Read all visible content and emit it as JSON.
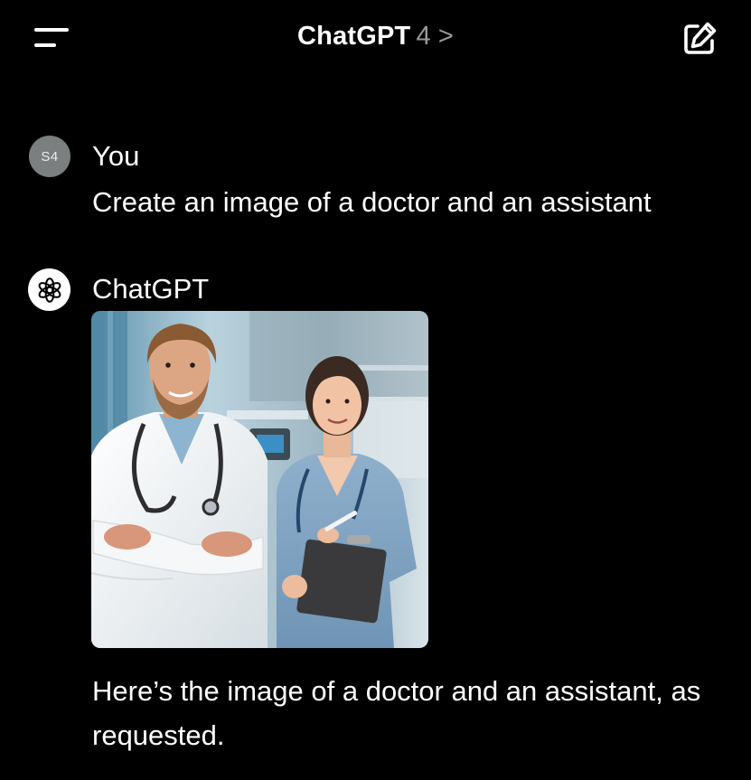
{
  "header": {
    "title": "ChatGPT",
    "version": "4",
    "chevron": ">",
    "menu_icon": "menu-icon",
    "new_chat_icon": "compose-icon"
  },
  "user_message": {
    "avatar_initials": "S4",
    "author": "You",
    "text": "Create an image of a doctor and an assistant"
  },
  "assistant_message": {
    "avatar_icon": "openai-logo-icon",
    "author": "ChatGPT",
    "image": "generated image: smiling male doctor in white coat with stethoscope and female assistant in blue scrubs holding a clipboard, hospital room background",
    "text": "Here’s the image of a doctor and an assistant, as requested."
  },
  "colors": {
    "background": "#000000",
    "text": "#ffffff",
    "muted": "#9a9a9a",
    "user_avatar": "#7c7f80"
  }
}
